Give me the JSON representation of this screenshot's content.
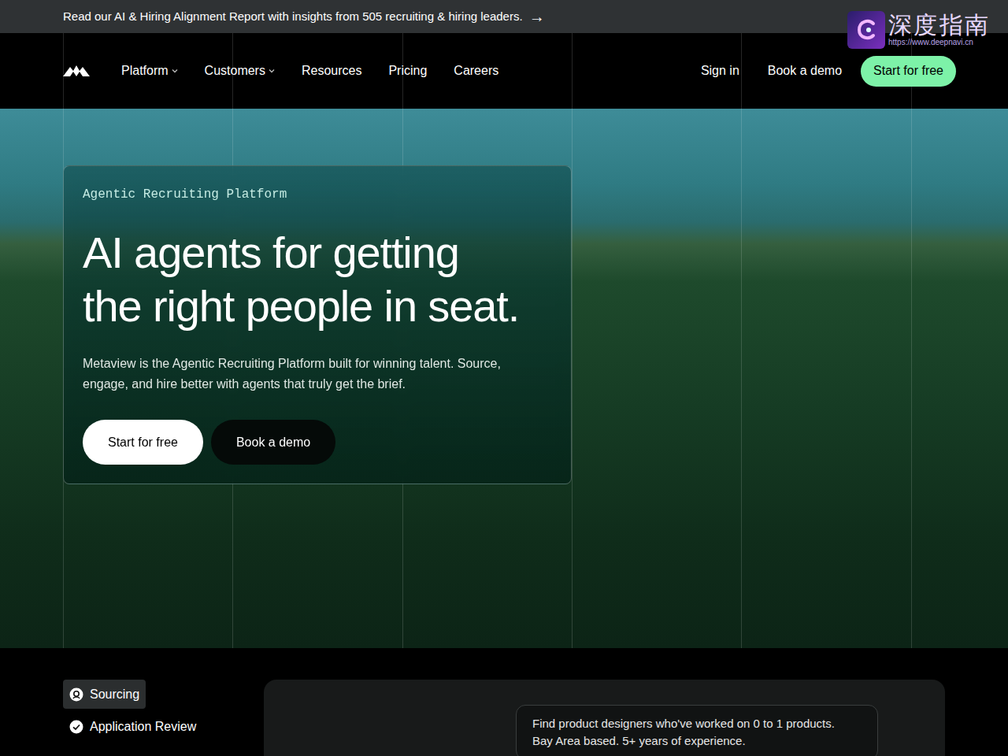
{
  "banner": {
    "text": "Read our AI & Hiring Alignment Report with insights from 505 recruiting & hiring leaders.",
    "arrow": "→"
  },
  "watermark": {
    "title": "深度指南",
    "url": "https://www.deepnavi.cn"
  },
  "nav": {
    "items": [
      {
        "label": "Platform",
        "dropdown": true
      },
      {
        "label": "Customers",
        "dropdown": true
      },
      {
        "label": "Resources",
        "dropdown": false
      },
      {
        "label": "Pricing",
        "dropdown": false
      },
      {
        "label": "Careers",
        "dropdown": false
      }
    ],
    "sign_in": "Sign in",
    "book_demo": "Book a demo",
    "start": "Start for free"
  },
  "hero": {
    "eyebrow": "Agentic Recruiting Platform",
    "heading_lines": [
      "AI agents for getting",
      "the right people in seat."
    ],
    "description": "Metaview is the Agentic Recruiting Platform built for winning talent. Source, engage, and hire better with agents that truly get the brief.",
    "buttons": [
      "Start for free",
      "Book a demo"
    ]
  },
  "features": {
    "tabs": [
      {
        "label": "Sourcing",
        "selected": true
      },
      {
        "label": "Application Review",
        "selected": false
      }
    ]
  },
  "preview": {
    "prompt_lines": [
      "Find product designers who've worked on 0 to 1 products.",
      "Bay Area based. 5+ years of experience."
    ]
  }
}
